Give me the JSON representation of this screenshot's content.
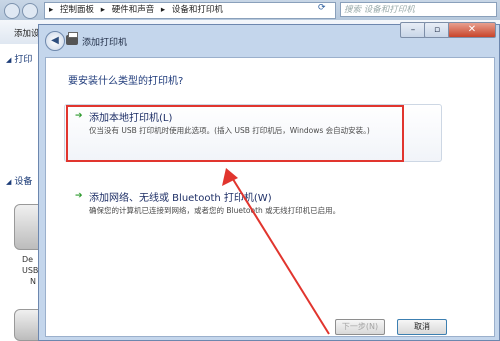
{
  "explorer": {
    "breadcrumb": [
      "控制面板",
      "硬件和声音",
      "设备和打印机"
    ],
    "search_placeholder": "搜索 设备和打印机",
    "toolbar_label": "添加设",
    "section_printers": "打印",
    "section_devices": "设备",
    "device_label_1": "De",
    "device_label_2": "USB",
    "device_label_3": "N"
  },
  "dialog": {
    "title": "添加打印机",
    "question": "要安装什么类型的打印机?",
    "option_local": {
      "title": "添加本地打印机(L)",
      "description": "仅当没有 USB 打印机时使用此选项。(插入 USB 打印机后，Windows 会自动安装。)"
    },
    "option_network": {
      "title": "添加网络、无线或 Bluetooth 打印机(W)",
      "description": "确保您的计算机已连接到网络，或者您的 Bluetooth 或无线打印机已启用。"
    },
    "next_button": "下一步(N)",
    "cancel_button": "取消"
  },
  "colors": {
    "highlight": "#e1352e",
    "annotation_arrow": "#e1352e",
    "option_arrow": "#2f9b2f"
  }
}
